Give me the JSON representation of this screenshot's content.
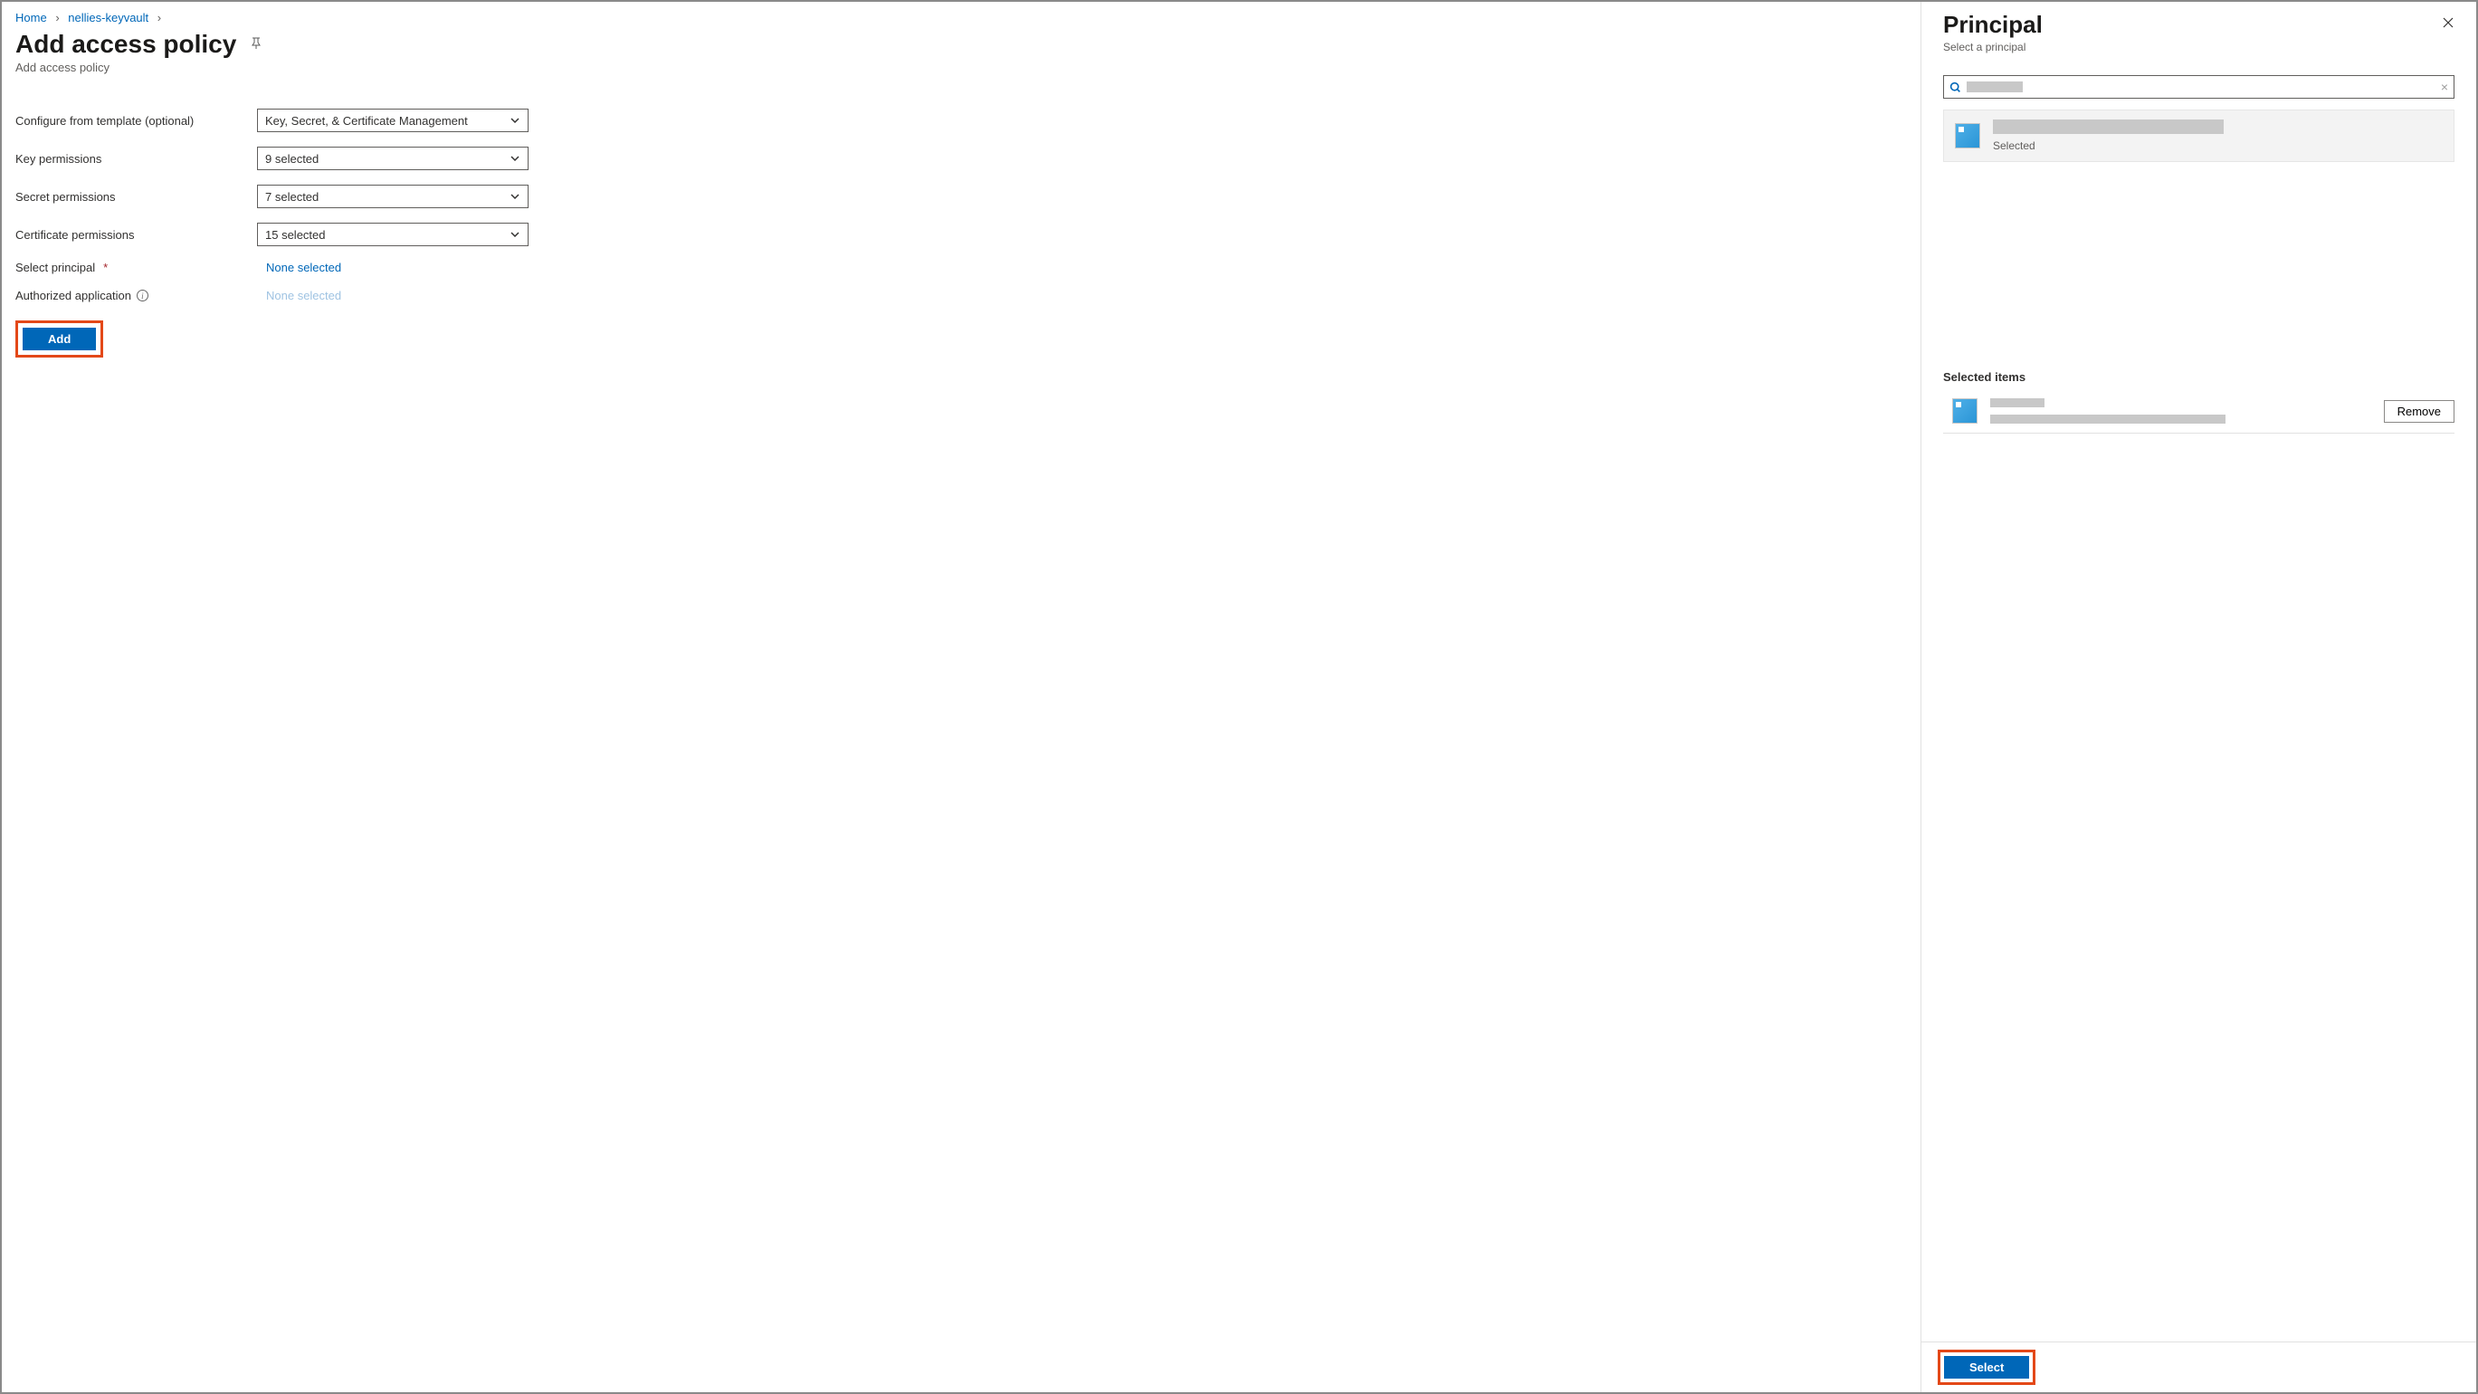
{
  "breadcrumb": {
    "home": "Home",
    "vault": "nellies-keyvault"
  },
  "page": {
    "title": "Add access policy",
    "subtitle": "Add access policy"
  },
  "form": {
    "template_label": "Configure from template (optional)",
    "template_value": "Key, Secret, & Certificate Management",
    "key_label": "Key permissions",
    "key_value": "9 selected",
    "secret_label": "Secret permissions",
    "secret_value": "7 selected",
    "cert_label": "Certificate permissions",
    "cert_value": "15 selected",
    "principal_label": "Select principal",
    "principal_value": "None selected",
    "app_label": "Authorized application",
    "app_value": "None selected",
    "add_button": "Add"
  },
  "panel": {
    "title": "Principal",
    "subtitle": "Select a principal",
    "result_selected_label": "Selected",
    "selected_items_heading": "Selected items",
    "remove_button": "Remove",
    "select_button": "Select"
  }
}
